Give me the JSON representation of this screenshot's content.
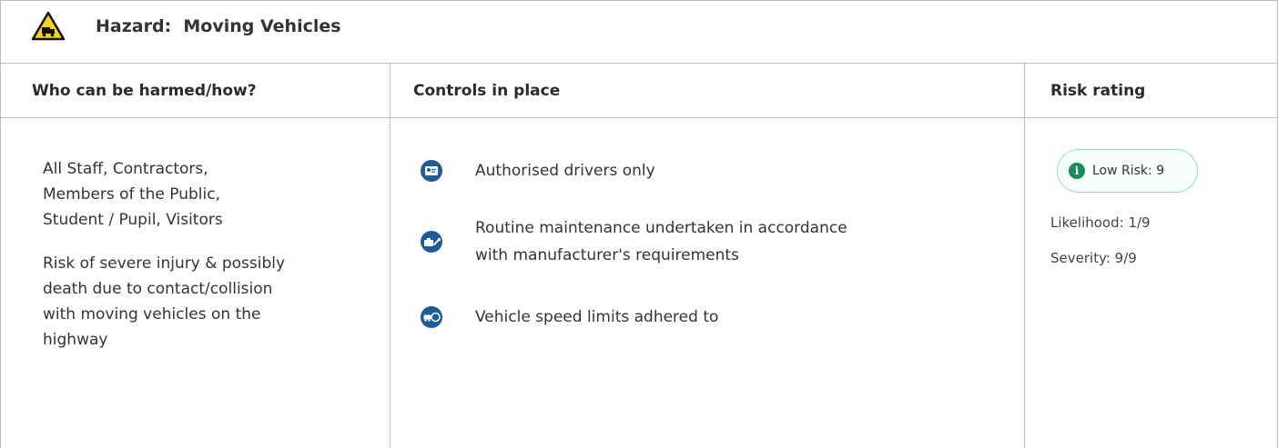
{
  "hazard": {
    "title": "Hazard:  Moving Vehicles",
    "icon": "vehicle-warning-icon"
  },
  "columns": {
    "who": "Who can be harmed/how?",
    "controls": "Controls in place",
    "risk": "Risk rating"
  },
  "who": {
    "people_lines": [
      "All Staff, Contractors,",
      "Members of the Public,",
      "Student / Pupil, Visitors"
    ],
    "description_lines": [
      "Risk of severe injury & possibly",
      "death due to contact/collision",
      "with moving vehicles on the",
      "highway"
    ]
  },
  "controls": [
    {
      "icon": "driver-pass-icon",
      "lines": [
        "Authorised drivers only"
      ]
    },
    {
      "icon": "toolbox-wrench-icon",
      "lines": [
        "Routine maintenance undertaken in accordance",
        "with manufacturer's requirements"
      ]
    },
    {
      "icon": "vehicle-speed-limit-icon",
      "lines": [
        "Vehicle speed limits adhered to"
      ]
    }
  ],
  "risk": {
    "badge_label": "Low Risk: 9",
    "badge_icon": "info-icon",
    "badge_color": "#1c8a58",
    "likelihood": "Likelihood: 1/9",
    "severity": "Severity: 9/9"
  },
  "colors": {
    "border": "#bdbdbd",
    "control_icon": "#1f5b97",
    "hazard_yellow": "#f4d21f"
  }
}
